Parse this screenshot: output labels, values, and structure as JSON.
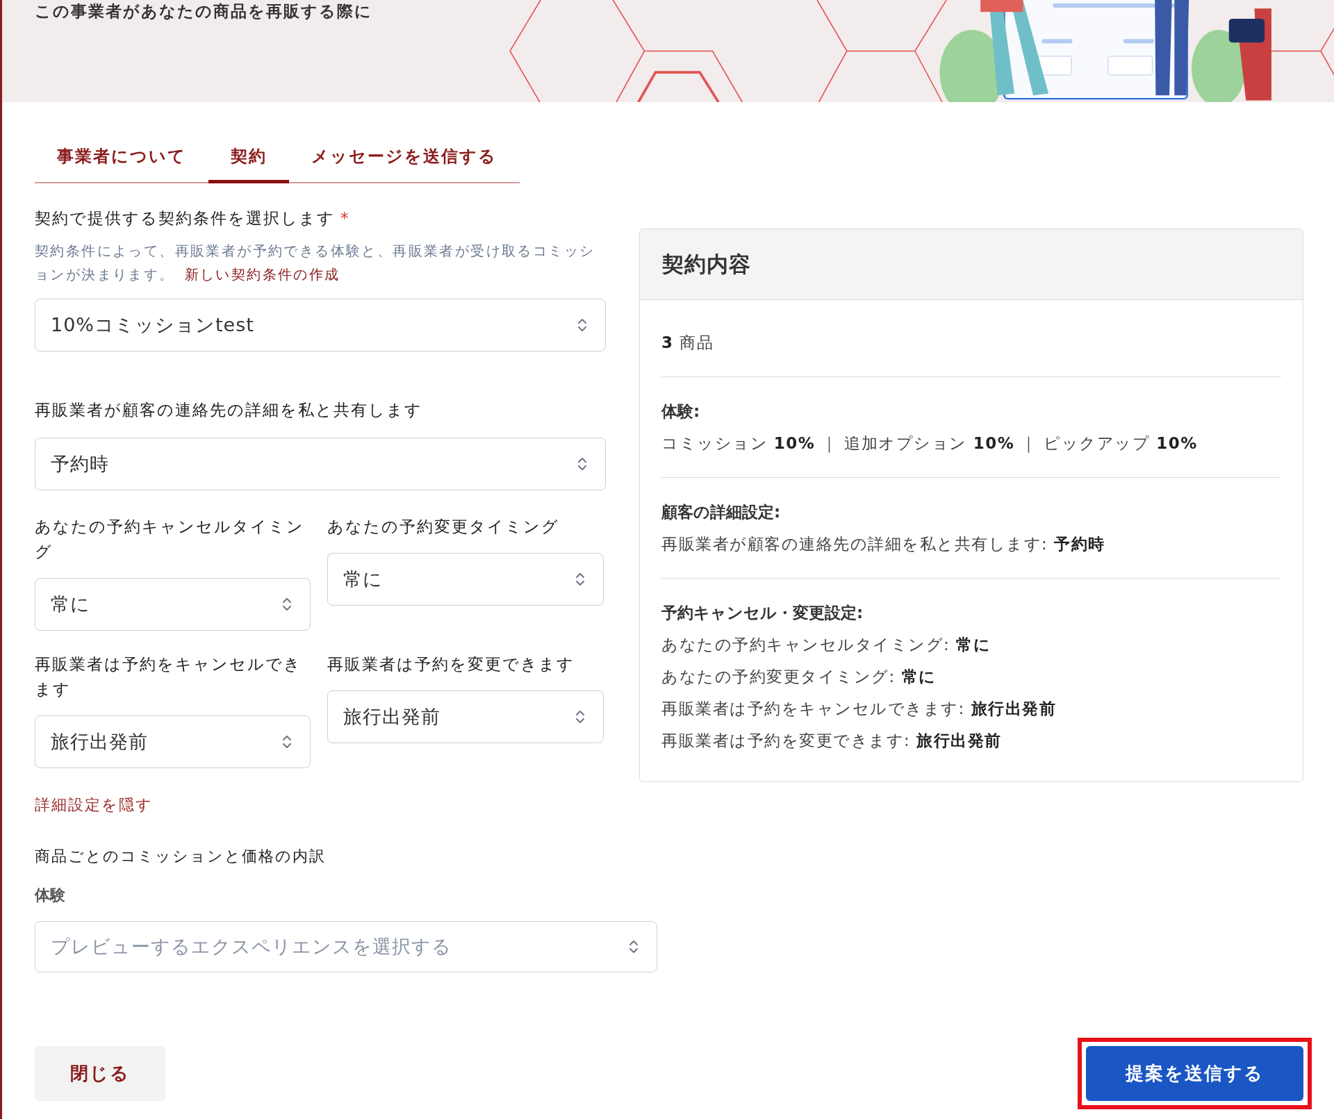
{
  "header": {
    "title": "この事業者があなたの商品を再販する際に"
  },
  "tabs": [
    {
      "label": "事業者について",
      "selected": false
    },
    {
      "label": "契約",
      "selected": true
    },
    {
      "label": "メッセージを送信する",
      "selected": false
    }
  ],
  "contract_terms": {
    "label": "契約で提供する契約条件を選択します",
    "required_mark": "*",
    "hint": "契約条件によって、再販業者が予約できる体験と、再販業者が受け取るコミッションが決まります。",
    "link": "新しい契約条件の作成",
    "value": "10%コミッションtest"
  },
  "contact_sharing": {
    "label": "再販業者が顧客の連絡先の詳細を私と共有します",
    "value": "予約時"
  },
  "timing_fields": [
    {
      "label": "あなたの予約キャンセルタイミング",
      "value": "常に"
    },
    {
      "label": "あなたの予約変更タイミング",
      "value": "常に"
    },
    {
      "label": "再販業者は予約をキャンセルできます",
      "value": "旅行出発前"
    },
    {
      "label": "再販業者は予約を変更できます",
      "value": "旅行出発前"
    }
  ],
  "toggle_link": "詳細設定を隠す",
  "breakdown": {
    "title": "商品ごとのコミッションと価格の内訳",
    "label": "体験",
    "placeholder": "プレビューするエクスペリエンスを選択する"
  },
  "summary": {
    "title": "契約内容",
    "sections": [
      {
        "lines": [
          "**3** 商品"
        ]
      },
      {
        "heading": "体験:",
        "lines": [
          "コミッション **10%** ｜ 追加オプション **10%** ｜ ピックアップ **10%**"
        ]
      },
      {
        "heading": "顧客の詳細設定:",
        "lines": [
          "再販業者が顧客の連絡先の詳細を私と共有します: **予約時**"
        ]
      },
      {
        "heading": "予約キャンセル・変更設定:",
        "lines": [
          "あなたの予約キャンセルタイミング: **常に**",
          "あなたの予約変更タイミング: **常に**",
          "再販業者は予約をキャンセルできます: **旅行出発前**",
          "再販業者は予約を変更できます: **旅行出発前**"
        ]
      }
    ]
  },
  "buttons": {
    "close": "閉じる",
    "submit": {
      "label": "提案を送信する",
      "highlighted": true
    }
  }
}
